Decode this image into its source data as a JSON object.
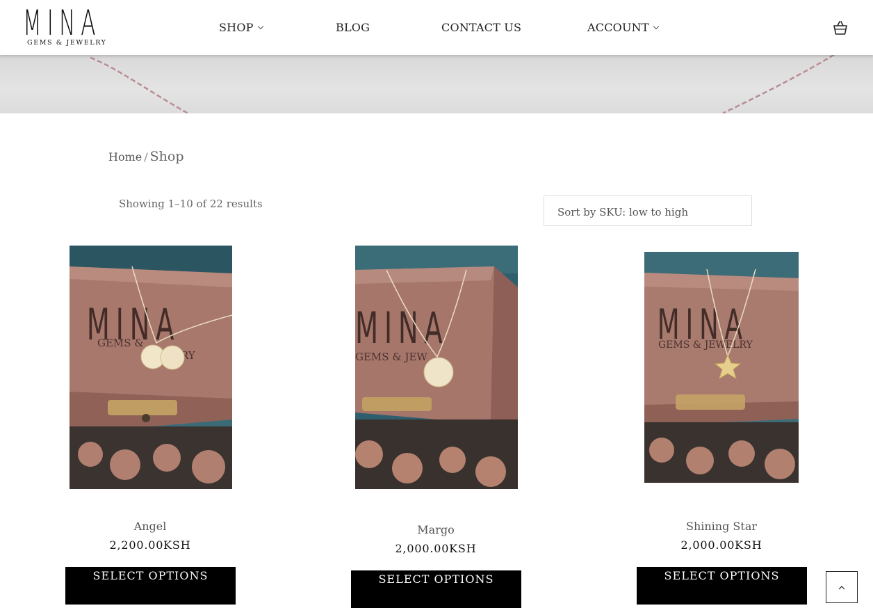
{
  "brand": {
    "logo_text": "MINA",
    "logo_sub": "GEMS & JEWELRY"
  },
  "nav": {
    "shop": "SHOP",
    "blog": "BLOG",
    "contact": "CONTACT US",
    "account": "ACCOUNT"
  },
  "icons": {
    "cart": "basket-icon",
    "back_to_top": "chevron-up-icon"
  },
  "breadcrumb": {
    "home": "Home",
    "separator": "/",
    "current": "Shop"
  },
  "results": {
    "text": "Showing 1–10 of 22 results"
  },
  "sort": {
    "selected": "Sort by SKU: low to high"
  },
  "products": [
    {
      "name": "Angel",
      "price": "2,200.00KSH",
      "button": "SELECT OPTIONS"
    },
    {
      "name": "Margo",
      "price": "2,000.00KSH",
      "button": "SELECT OPTIONS"
    },
    {
      "name": "Shining Star",
      "price": "2,000.00KSH",
      "button": "SELECT OPTIONS"
    }
  ],
  "colors": {
    "button_bg": "#000000",
    "button_text": "#ffffff",
    "box_wood": "#a9786d",
    "teal_bg": "#2d5d6b"
  }
}
